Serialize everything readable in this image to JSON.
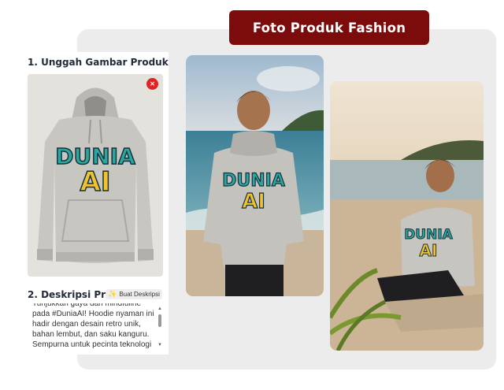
{
  "header": {
    "title": "Foto Produk Fashion"
  },
  "upload": {
    "label": "1. Unggah Gambar Produk",
    "remove_symbol": "×",
    "product_print": {
      "line1": "DUNIA",
      "line2": "AI"
    }
  },
  "description": {
    "label": "2. Deskripsi Produk",
    "generate_button": "Buat Deskripsi",
    "text": "Tunjukkan gaya dan mindfullne pada #DuniaAI! Hoodie nyaman ini hadir dengan desain retro unik, bahan lembut, dan saku kanguru. Sempurna untuk pecinta teknologi dan gaya"
  },
  "photos": [
    {
      "scene": "standing-beach",
      "print_line1": "DUNIA",
      "print_line2": "AI"
    },
    {
      "scene": "sitting-sand",
      "print_line1": "DUNIA",
      "print_line2": "AI"
    }
  ],
  "colors": {
    "brand_red": "#7c0c0c",
    "remove_red": "#e02424",
    "print_teal": "#2aa7a0",
    "print_yellow": "#f2c12e"
  }
}
